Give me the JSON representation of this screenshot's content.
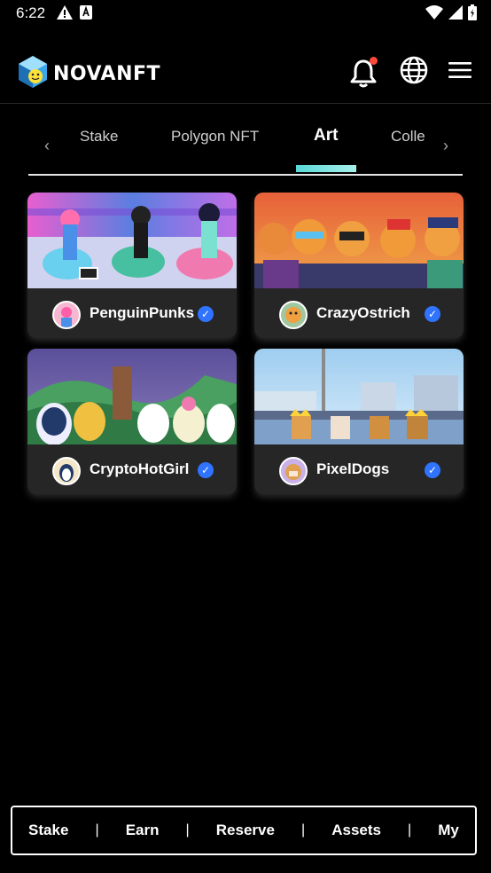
{
  "status": {
    "time": "6:22",
    "icons": [
      "warning-icon",
      "notification-app-icon",
      "wifi-icon",
      "signal-icon",
      "battery-icon"
    ]
  },
  "header": {
    "logo_text": "NOVANFT",
    "icons": [
      "bell-icon",
      "globe-icon",
      "menu-icon"
    ],
    "bell_dot_color": "#ff4a3a"
  },
  "tabs": {
    "items": [
      {
        "label": "Stake"
      },
      {
        "label": "Polygon NFT"
      },
      {
        "label": "Art"
      },
      {
        "label": "Colle"
      }
    ],
    "active_index": 2,
    "indicator_color": "#5ad7d7"
  },
  "collections": [
    {
      "name": "PenguinPunks",
      "verified": true
    },
    {
      "name": "CrazyOstrich",
      "verified": true
    },
    {
      "name": "CryptoHotGirl",
      "verified": true
    },
    {
      "name": "PixelDogs",
      "verified": true
    }
  ],
  "bottom_nav": {
    "items": [
      {
        "label": "Stake"
      },
      {
        "label": "Earn"
      },
      {
        "label": "Reserve"
      },
      {
        "label": "Assets"
      },
      {
        "label": "My"
      }
    ]
  },
  "colors": {
    "background": "#000000",
    "card": "#262626",
    "verified": "#2f73ff"
  }
}
